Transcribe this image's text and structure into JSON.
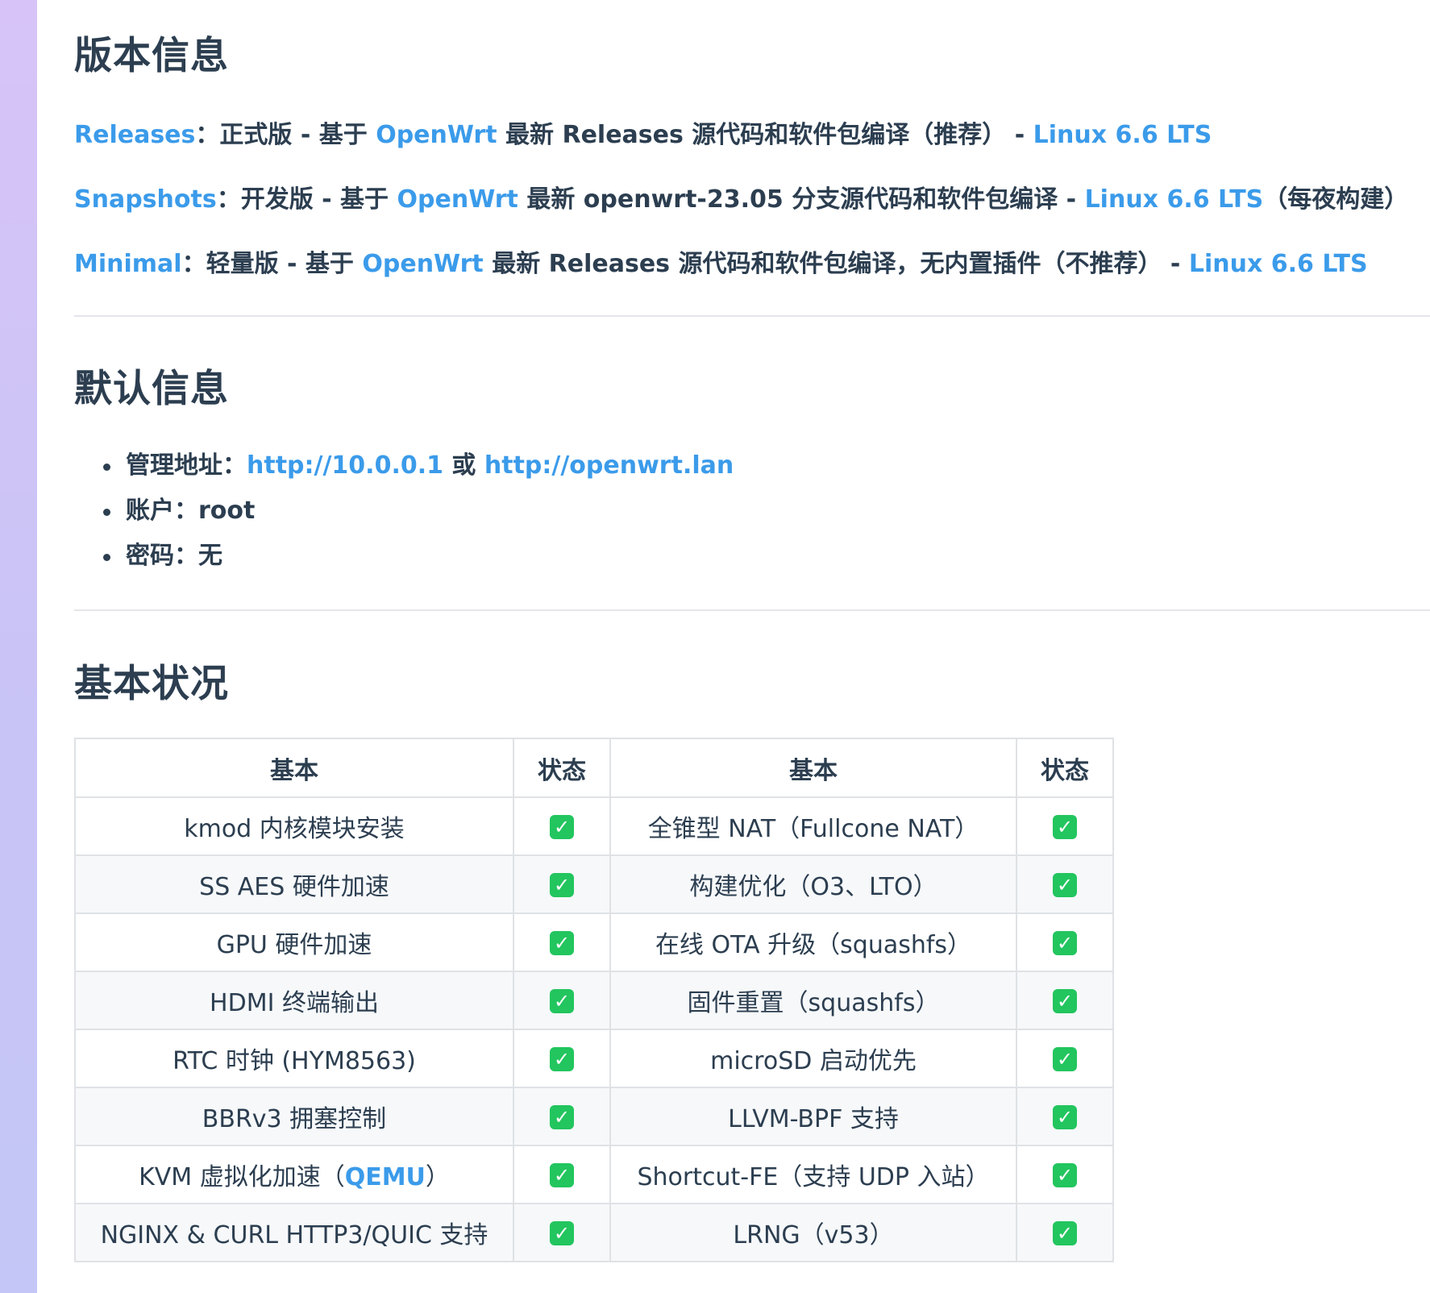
{
  "versions": {
    "heading": "版本信息",
    "items": [
      {
        "link": "Releases",
        "sep": "：",
        "pre": "正式版 - 基于 ",
        "openwrt": "OpenWrt",
        "post": " 最新 Releases 源代码和软件包编译（推荐） - ",
        "kernel": "Linux 6.6 LTS",
        "tail": ""
      },
      {
        "link": "Snapshots",
        "sep": "：",
        "pre": "开发版 - 基于 ",
        "openwrt": "OpenWrt",
        "post": " 最新 openwrt-23.05 分支源代码和软件包编译 - ",
        "kernel": "Linux 6.6 LTS",
        "tail": "（每夜构建）"
      },
      {
        "link": "Minimal",
        "sep": "：",
        "pre": "轻量版 - 基于 ",
        "openwrt": "OpenWrt",
        "post": " 最新 Releases 源代码和软件包编译，无内置插件（不推荐） - ",
        "kernel": "Linux 6.6 LTS",
        "tail": ""
      }
    ]
  },
  "defaults": {
    "heading": "默认信息",
    "admin_label": "管理地址：",
    "admin_url1": "http://10.0.0.1",
    "admin_or": " 或 ",
    "admin_url2": "http://openwrt.lan",
    "account_label": "账户：",
    "account_value": "root",
    "password_label": "密码：",
    "password_value": "无"
  },
  "status": {
    "heading": "基本状况",
    "headers": [
      "基本",
      "状态",
      "基本",
      "状态"
    ],
    "check_icon": "check-mark-button-icon",
    "rows": [
      {
        "left": "kmod 内核模块安装",
        "right": "全锥型 NAT（Fullcone NAT）"
      },
      {
        "left": "SS AES 硬件加速",
        "right": "构建优化（O3、LTO）"
      },
      {
        "left": "GPU 硬件加速",
        "right": "在线 OTA 升级（squashfs）"
      },
      {
        "left": "HDMI 终端输出",
        "right": "固件重置（squashfs）"
      },
      {
        "left": "RTC 时钟 (HYM8563)",
        "right": "microSD 启动优先"
      },
      {
        "left": "BBRv3 拥塞控制",
        "right": "LLVM-BPF 支持"
      },
      {
        "left_pre": "KVM 虚拟化加速（",
        "left_link": "QEMU",
        "left_post": "）",
        "right": "Shortcut-FE（支持 UDP 入站）"
      },
      {
        "left": "NGINX & CURL HTTP3/QUIC 支持",
        "right": "LRNG（v53）"
      }
    ],
    "check_symbol": "✓"
  },
  "colors": {
    "text": "#2c3e50",
    "link": "#3b9bea",
    "check": "#22c55e",
    "sidebar": "#cfc3f6"
  }
}
